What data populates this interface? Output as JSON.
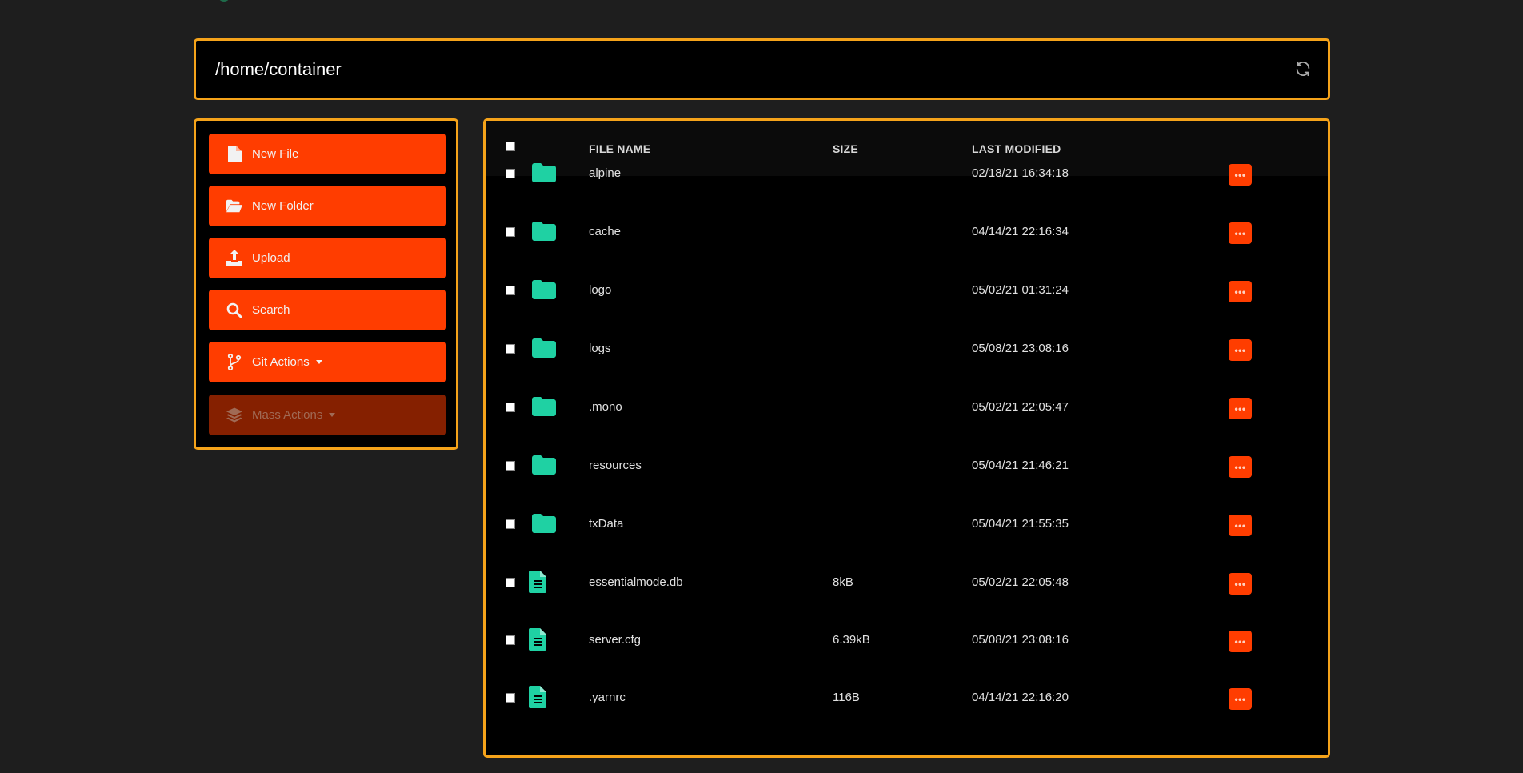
{
  "path": "/home/container",
  "sidebar": {
    "buttons": [
      {
        "label": "New File",
        "icon": "file-icon"
      },
      {
        "label": "New Folder",
        "icon": "folder-open-icon"
      },
      {
        "label": "Upload",
        "icon": "upload-icon"
      },
      {
        "label": "Search",
        "icon": "search-icon"
      },
      {
        "label": "Git Actions",
        "icon": "git-branch-icon",
        "dropdown": true
      },
      {
        "label": "Mass Actions",
        "icon": "layers-icon",
        "dropdown": true,
        "disabled": true
      }
    ]
  },
  "table": {
    "headers": {
      "name": "FILE NAME",
      "size": "SIZE",
      "modified": "LAST MODIFIED"
    },
    "rows": [
      {
        "type": "folder",
        "name": "alpine",
        "size": "",
        "modified": "02/18/21 16:34:18"
      },
      {
        "type": "folder",
        "name": "cache",
        "size": "",
        "modified": "04/14/21 22:16:34"
      },
      {
        "type": "folder",
        "name": "logo",
        "size": "",
        "modified": "05/02/21 01:31:24"
      },
      {
        "type": "folder",
        "name": "logs",
        "size": "",
        "modified": "05/08/21 23:08:16"
      },
      {
        "type": "folder",
        "name": ".mono",
        "size": "",
        "modified": "05/02/21 22:05:47"
      },
      {
        "type": "folder",
        "name": "resources",
        "size": "",
        "modified": "05/04/21 21:46:21"
      },
      {
        "type": "folder",
        "name": "txData",
        "size": "",
        "modified": "05/04/21 21:55:35"
      },
      {
        "type": "file",
        "name": "essentialmode.db",
        "size": "8kB",
        "modified": "05/02/21 22:05:48"
      },
      {
        "type": "file",
        "name": "server.cfg",
        "size": "6.39kB",
        "modified": "05/08/21 23:08:16"
      },
      {
        "type": "file",
        "name": ".yarnrc",
        "size": "116B",
        "modified": "04/14/21 22:16:20"
      }
    ]
  },
  "colors": {
    "accent_border": "#f5a31a",
    "button": "#ff3d00",
    "button_disabled": "#852000",
    "file_icon": "#1fd1a3",
    "background": "#1e1e1e"
  }
}
